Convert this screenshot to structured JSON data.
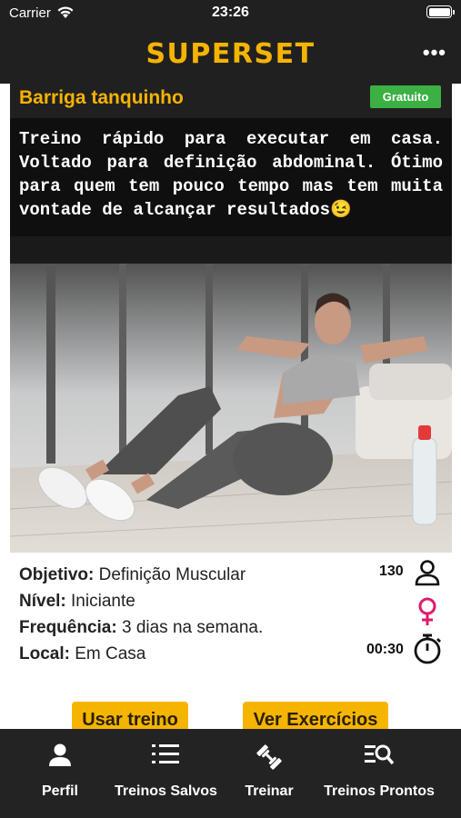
{
  "status_bar": {
    "carrier": "Carrier",
    "time": "23:26"
  },
  "header": {
    "logo": "SUPERSET",
    "more_label": "•••"
  },
  "workout": {
    "title": "Barriga tanquinho",
    "badge": "Gratuito",
    "description": "Treino rápido para executar em casa. Voltado para definição abdominal. Ótimo para quem tem pouco tempo mas tem muita vontade de alcançar resultados😉",
    "details": [
      {
        "label": "Objetivo:",
        "value": "Definição Muscular"
      },
      {
        "label": "Nível:",
        "value": "Iniciante"
      },
      {
        "label": "Frequência:",
        "value": "3 dias na semana."
      },
      {
        "label": "Local:",
        "value": "Em Casa"
      }
    ],
    "users_count": "130",
    "duration": "00:30",
    "icons": {
      "users": "person-icon",
      "gender": "female-symbol-icon",
      "duration": "stopwatch-icon"
    }
  },
  "actions": {
    "use": "Usar treino",
    "exercises": "Ver Exercícios"
  },
  "tabs": [
    {
      "label": "Perfil",
      "icon": "person-icon"
    },
    {
      "label": "Treinos Salvos",
      "icon": "list-icon"
    },
    {
      "label": "Treinar",
      "icon": "dumbbell-icon"
    },
    {
      "label": "Treinos Prontos",
      "icon": "search-list-icon"
    }
  ],
  "colors": {
    "accent": "#f5b400",
    "badge": "#3cb043",
    "gender": "#e0196b",
    "bar": "#202020"
  }
}
